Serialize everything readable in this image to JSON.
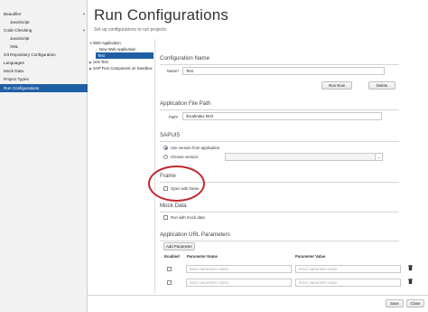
{
  "sidebar": {
    "items": [
      {
        "label": "Beautifier",
        "sub": false,
        "chevron": true
      },
      {
        "label": "JavaScript",
        "sub": true
      },
      {
        "label": "Code Checking",
        "sub": false,
        "chevron": true
      },
      {
        "label": "JavaScript",
        "sub": true
      },
      {
        "label": "XML",
        "sub": true
      },
      {
        "label": "Git Repository Configuration",
        "sub": false
      },
      {
        "label": "Languages",
        "sub": false
      },
      {
        "label": "Mock Data",
        "sub": false
      },
      {
        "label": "Project Types",
        "sub": false
      },
      {
        "label": "Run Configurations",
        "sub": false,
        "active": true
      }
    ]
  },
  "header": {
    "title": "Run Configurations",
    "subtitle": "Set up configurations to run projects"
  },
  "tree": {
    "items": [
      {
        "label": "Web Application",
        "level": 0,
        "expanded": true
      },
      {
        "label": "New Web Application",
        "level": 1
      },
      {
        "label": "Test",
        "level": 1,
        "selected": true
      },
      {
        "label": "Unit Test",
        "level": 0,
        "expanded": false
      },
      {
        "label": "SAP Fiori Component on Sandbox",
        "level": 0,
        "expanded": false
      }
    ]
  },
  "configuration_name": {
    "heading": "Configuration Name",
    "label": "Name*",
    "value": "Test",
    "run_now": "Run Now",
    "delete": "Delete"
  },
  "file_path": {
    "heading": "Application File Path",
    "label": "Path*",
    "value": "/localIndex.html"
  },
  "sapui5": {
    "heading": "SAPUI5",
    "use_version": "Use version from application",
    "choose_version": "Choose version:"
  },
  "frame": {
    "heading": "Frame",
    "open_with_frame": "Open with frame"
  },
  "mock_data": {
    "heading": "Mock Data",
    "run_with_mock": "Run with mock data"
  },
  "url_params": {
    "heading": "Application URL Parameters",
    "add_button": "Add Parameter",
    "col_enabled": "Enabled",
    "col_name": "Parameter Name",
    "col_value": "Parameter Value",
    "rows": [
      {
        "name_placeholder": "Enter parameter name",
        "value_placeholder": "Enter parameter value"
      },
      {
        "name_placeholder": "Enter parameter name",
        "value_placeholder": "Enter parameter value"
      }
    ]
  },
  "footer": {
    "save": "Save",
    "close": "Close"
  },
  "colors": {
    "accent": "#1f5fa6",
    "highlight": "#c1272d"
  }
}
